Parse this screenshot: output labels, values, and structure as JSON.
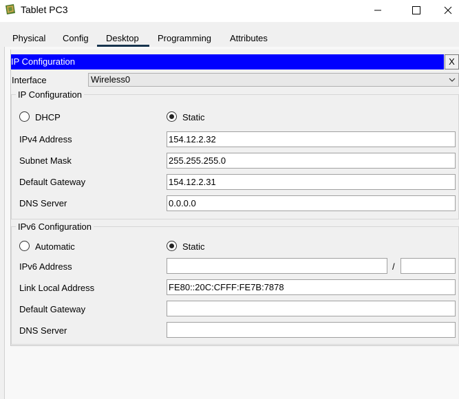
{
  "window": {
    "title": "Tablet PC3"
  },
  "tabs": [
    "Physical",
    "Config",
    "Desktop",
    "Programming",
    "Attributes"
  ],
  "panel": {
    "title": "IP Configuration",
    "close_label": "X"
  },
  "interface": {
    "label": "Interface",
    "value": "Wireless0"
  },
  "ipv4": {
    "group_title": "IP Configuration",
    "dhcp_label": "DHCP",
    "static_label": "Static",
    "selected": "Static",
    "ipv4_label": "IPv4 Address",
    "ipv4_value": "154.12.2.32",
    "mask_label": "Subnet Mask",
    "mask_value": "255.255.255.0",
    "gateway_label": "Default Gateway",
    "gateway_value": "154.12.2.31",
    "dns_label": "DNS Server",
    "dns_value": "0.0.0.0"
  },
  "ipv6": {
    "group_title": "IPv6 Configuration",
    "auto_label": "Automatic",
    "static_label": "Static",
    "selected": "Static",
    "address_label": "IPv6 Address",
    "address_value": "",
    "prefix_sep": "/",
    "prefix_value": "",
    "link_local_label": "Link Local Address",
    "link_local_value": "FE80::20C:CFFF:FE7B:7878",
    "gateway_label": "Default Gateway",
    "gateway_value": "",
    "dns_label": "DNS Server",
    "dns_value": ""
  }
}
